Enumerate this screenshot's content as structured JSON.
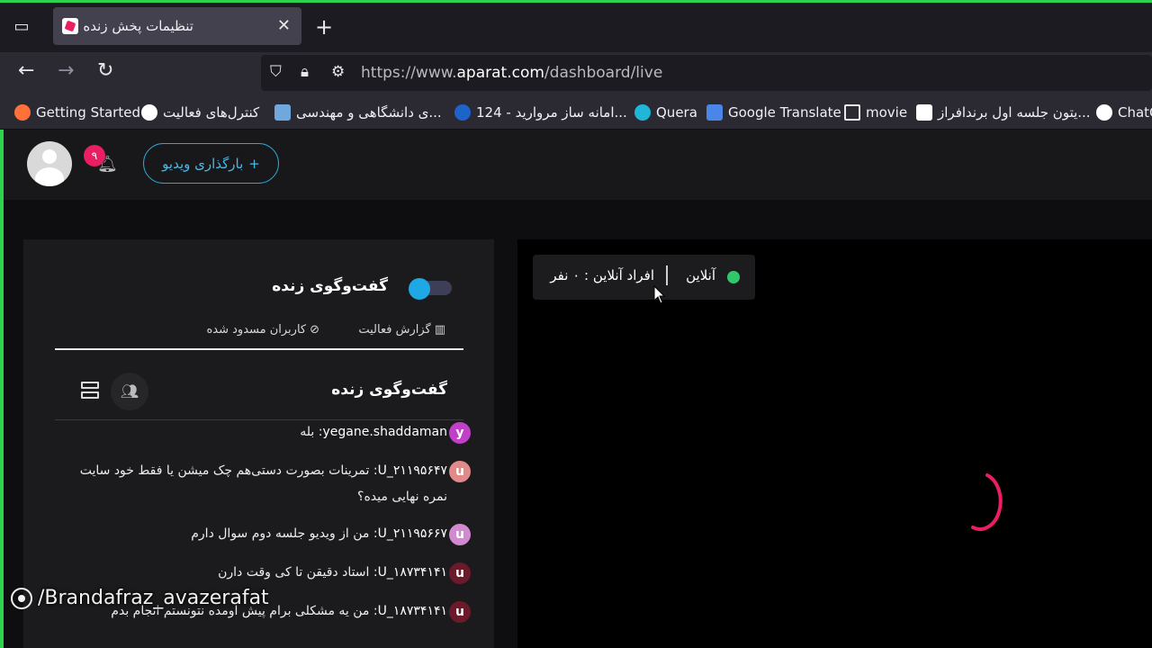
{
  "browser": {
    "tab": {
      "title": "تنظیمات پخش زنده"
    },
    "url": {
      "prefix": "https://www.",
      "domain": "aparat.com",
      "path": "/dashboard/live"
    },
    "bookmarks": [
      {
        "label": "Getting Started",
        "color": "#ff7139"
      },
      {
        "label": "کنترل‌های فعالیت",
        "color": "#ffffff"
      },
      {
        "label": "...ی دانشگاهی و مهندسی",
        "color": "#6fa8dc"
      },
      {
        "label": "...امانه ساز مروارید - 124",
        "color": "#1e63c8"
      },
      {
        "label": "Quera",
        "color": "#1fb6d8"
      },
      {
        "label": "Google Translate",
        "color": "#4a86e8"
      },
      {
        "label": "movie",
        "color": "transparent"
      },
      {
        "label": "...یتون جلسه اول برندافراز",
        "color": "#e91e63"
      },
      {
        "label": "ChatG",
        "color": "#ffffff"
      }
    ]
  },
  "header": {
    "notification_count": "۹",
    "upload_label": "بارگذاری ویدیو"
  },
  "chat": {
    "toggle_label": "گفت‌وگوی زنده",
    "tabs": {
      "activity": "گزارش فعالیت",
      "blocked": "کاربران مسدود شده"
    },
    "title": "گفت‌وگوی زنده",
    "messages": [
      {
        "initial": "y",
        "color": "#c040c8",
        "user": "yegane.shaddaman",
        "text": ": بله"
      },
      {
        "initial": "u",
        "color": "#e08a8a",
        "user": "U_۲۱۱۹۵۶۴۷",
        "text": ": تمرینات بصورت دستی‌هم چک میشن یا فقط خود سایت نمره نهایی میده؟"
      },
      {
        "initial": "u",
        "color": "#d08ad0",
        "user": "U_۲۱۱۹۵۶۶۷",
        "text": ": من از ویدیو جلسه دوم سوال دارم"
      },
      {
        "initial": "u",
        "color": "#6a1a2a",
        "user": "U_۱۸۷۳۴۱۴۱",
        "text": ": استاد دقیقن تا کی وقت دارن"
      },
      {
        "initial": "u",
        "color": "#6a1a2a",
        "user": "U_۱۸۷۳۴۱۴۱",
        "text": ": من یه مشکلی برام پیش اومده نتونستم انجام بدم"
      }
    ]
  },
  "video": {
    "status_online": "آنلاین",
    "online_count": "افراد آنلاین : ۰ نفر"
  },
  "watermark": "/Brandafraz_avazerafat",
  "colors": {
    "accent": "#e91e63",
    "link_blue": "#49b8e6",
    "online_green": "#2ec76a"
  }
}
